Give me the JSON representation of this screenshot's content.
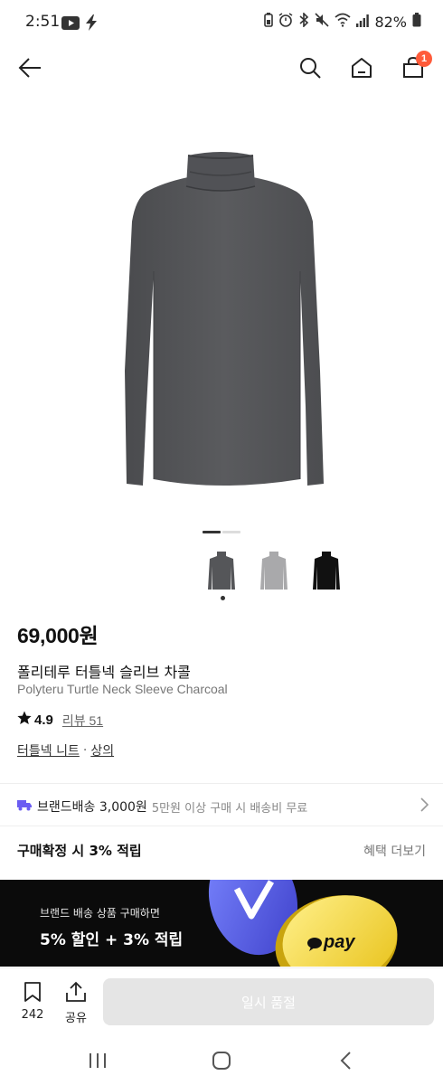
{
  "status_bar": {
    "time": "2:51",
    "battery": "82%",
    "left_icons": [
      "youtube-icon",
      "bolt-icon"
    ],
    "right_icons": [
      "battery-saver-icon",
      "alarm-icon",
      "bluetooth-icon",
      "mute-icon",
      "wifi-icon",
      "signal-icon",
      "battery-icon"
    ]
  },
  "header": {
    "back_icon": "arrow-left-icon",
    "search_icon": "search-icon",
    "home_icon": "home-icon",
    "cart_icon": "shopping-bag-icon",
    "cart_count": "1",
    "accent_color": "#ff5b3a"
  },
  "product": {
    "colors": [
      "#555659",
      "#a9a9ab",
      "#111111"
    ],
    "carousel_active_index": 0,
    "carousel_count": 2,
    "price": "69,000원",
    "name_ko": "폴리테루 터틀넥 슬리브 차콜",
    "name_en": "Polyteru Turtle Neck Sleeve Charcoal",
    "rating": "4.9",
    "review_label": "리뷰 51",
    "categories": [
      "터틀넥 니트",
      "상의"
    ],
    "category_separator": "·"
  },
  "shipping": {
    "icon": "truck-icon",
    "label": "브랜드배송 3,000원",
    "note": "5만원 이상 구매 시 배송비 무료"
  },
  "benefit": {
    "text": "구매확정 시 3% 적립",
    "more_label": "혜택 더보기"
  },
  "banner": {
    "line1": "브랜드 배송 상품 구매하면",
    "line2": "5% 할인 + 3% 적립",
    "coin_label": "pay"
  },
  "bottom_bar": {
    "like_count": "242",
    "share_label": "공유",
    "cta_label": "일시 품절"
  },
  "system_nav": [
    "recents-icon",
    "home-circle-icon",
    "back-chevron-icon"
  ]
}
